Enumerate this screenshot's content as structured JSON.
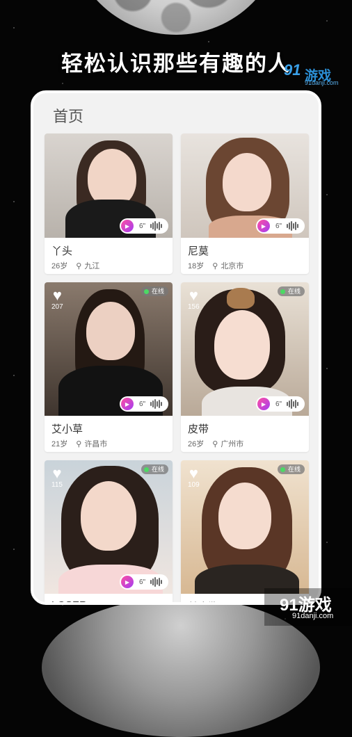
{
  "headline": "轻松认识那些有趣的人",
  "watermark_top": {
    "logo_num": "91",
    "logo_text": "游戏",
    "url": "91danji.com"
  },
  "watermark_bottom": {
    "logo": "91游戏",
    "url": "91danji.com"
  },
  "page": {
    "title": "首页"
  },
  "cards": [
    {
      "name": "丫头",
      "age": "26岁",
      "city": "九江",
      "likes": "",
      "online_label": "",
      "voice_duration": "6\""
    },
    {
      "name": "尼莫",
      "age": "18岁",
      "city": "北京市",
      "likes": "",
      "online_label": "",
      "voice_duration": "6\""
    },
    {
      "name": "艾小草",
      "age": "21岁",
      "city": "许昌市",
      "likes": "207",
      "online_label": "在线",
      "voice_duration": "6\""
    },
    {
      "name": "皮带",
      "age": "26岁",
      "city": "广州市",
      "likes": "156",
      "online_label": "在线",
      "voice_duration": "6\""
    },
    {
      "name": "LOSER",
      "age": "",
      "city": "",
      "likes": "115",
      "online_label": "在线",
      "voice_duration": "6\""
    },
    {
      "name": "单身狗",
      "age": "",
      "city": "",
      "likes": "109",
      "online_label": "在线",
      "voice_duration": ""
    }
  ],
  "colors": {
    "accent_play": "#c43cf0",
    "online_dot": "#4cd964"
  },
  "icons": {
    "like": "heart-icon",
    "location": "location-pin-icon",
    "play": "play-icon",
    "voice": "voice-wave-icon"
  }
}
